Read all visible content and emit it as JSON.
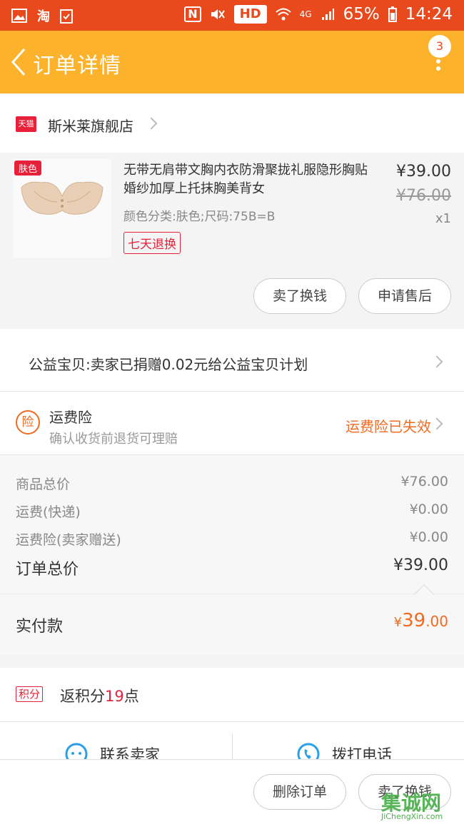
{
  "status_bar": {
    "battery": "65%",
    "time": "14:24",
    "hd": "HD",
    "network": "4G",
    "left_icons": [
      "image-icon",
      "taobao-icon",
      "clipboard-icon"
    ],
    "right_icons": [
      "nfc-icon",
      "mute-icon",
      "wifi-icon",
      "signal-icon",
      "battery-icon"
    ]
  },
  "nav": {
    "title": "订单详情",
    "badge_count": "3"
  },
  "shop": {
    "tag": "天猫",
    "name": "斯米莱旗舰店"
  },
  "item": {
    "color_tag": "肤色",
    "title": "无带无肩带文胸内衣防滑聚拢礼服隐形胸贴婚纱加厚上托抹胸美背女",
    "sku": "颜色分类:肤色;尺码:75B=B",
    "return_policy": "七天退换",
    "price": "¥39.00",
    "original_price": "¥76.00",
    "quantity": "x1",
    "buttons": [
      "卖了换钱",
      "申请售后"
    ]
  },
  "charity": {
    "text": "公益宝贝:卖家已捐赠0.02元给公益宝贝计划"
  },
  "insurance": {
    "icon_text": "险",
    "title": "运费险",
    "subtitle": "确认收货前退货可理赔",
    "status": "运费险已失效"
  },
  "summary": {
    "rows": [
      {
        "label": "商品总价",
        "value": "¥76.00"
      },
      {
        "label": "运费(快递)",
        "value": "¥0.00"
      },
      {
        "label": "运费险(卖家赠送)",
        "value": "¥0.00"
      }
    ],
    "total_label": "订单总价",
    "total_value": "¥39.00"
  },
  "payment": {
    "label": "实付款",
    "currency": "¥",
    "integer": "39",
    "decimal": ".00"
  },
  "points": {
    "tag": "积分",
    "prefix": "返积分",
    "value": "19",
    "suffix": "点"
  },
  "contact": {
    "seller": "联系卖家",
    "phone": "拨打电话"
  },
  "bottom": {
    "buttons": [
      "删除订单",
      "卖了换钱"
    ]
  },
  "watermark": {
    "main": "集诚网",
    "sub": "JiChengXin.com"
  }
}
